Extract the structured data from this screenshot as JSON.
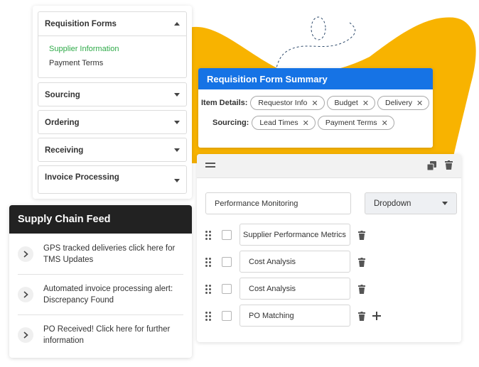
{
  "colors": {
    "accent_blue": "#1673e5",
    "accent_orange": "#f8b300",
    "active_green": "#2eaa48",
    "feed_header": "#222222"
  },
  "accordion": {
    "sections": [
      {
        "label": "Requisition Forms",
        "expanded": true,
        "items": [
          {
            "label": "Supplier Information",
            "active": true
          },
          {
            "label": "Payment Terms",
            "active": false
          }
        ]
      },
      {
        "label": "Sourcing",
        "expanded": false
      },
      {
        "label": "Ordering",
        "expanded": false
      },
      {
        "label": "Receiving",
        "expanded": false
      },
      {
        "label": "Invoice Processing",
        "expanded": false
      }
    ]
  },
  "summary": {
    "title": "Requisition Form Summary",
    "rows": [
      {
        "label": "Item Details:",
        "chips": [
          "Requestor Info",
          "Budget",
          "Delivery"
        ]
      },
      {
        "label": "Sourcing:",
        "chips": [
          "Lead Times",
          "Payment Terms"
        ]
      }
    ],
    "remove_icon": "close-icon"
  },
  "builder": {
    "toolbar_icons": [
      "menu-icon",
      "copy-icon",
      "trash-icon"
    ],
    "question": {
      "value": "Performance Monitoring"
    },
    "field_type": {
      "selected": "Dropdown"
    },
    "options": [
      {
        "value": "Supplier Performance Metrics",
        "checked": false
      },
      {
        "value": "Cost Analysis",
        "checked": false
      },
      {
        "value": "Cost Analysis",
        "checked": false
      },
      {
        "value": "PO Matching",
        "checked": false
      }
    ],
    "add_icon": "plus-icon"
  },
  "feed": {
    "title": "Supply Chain Feed",
    "items": [
      {
        "text": "GPS tracked deliveries click here for TMS Updates"
      },
      {
        "text": "Automated invoice processing alert: Discrepancy Found"
      },
      {
        "text": "PO Received! Click here for further information"
      }
    ]
  }
}
